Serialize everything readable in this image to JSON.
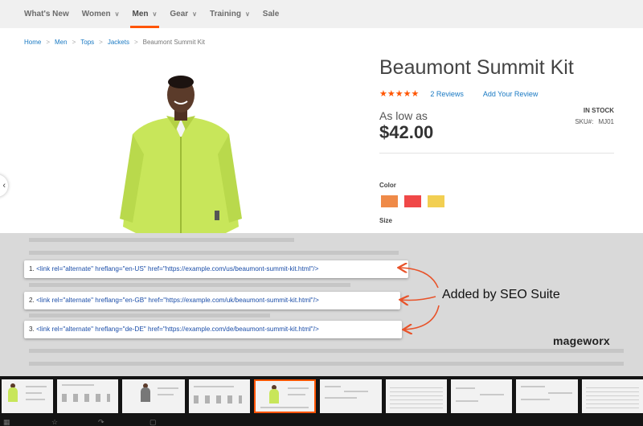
{
  "nav": {
    "items": [
      {
        "label": "What's New",
        "chevron": false,
        "active": false
      },
      {
        "label": "Women",
        "chevron": true,
        "active": false
      },
      {
        "label": "Men",
        "chevron": true,
        "active": true
      },
      {
        "label": "Gear",
        "chevron": true,
        "active": false
      },
      {
        "label": "Training",
        "chevron": true,
        "active": false
      },
      {
        "label": "Sale",
        "chevron": false,
        "active": false
      }
    ]
  },
  "breadcrumb": {
    "items": [
      "Home",
      "Men",
      "Tops",
      "Jackets"
    ],
    "current": "Beaumont Summit Kit"
  },
  "product": {
    "title": "Beaumont Summit Kit",
    "stars": "★★★★★",
    "rating": 4.5,
    "reviews_link": "2  Reviews",
    "add_review": "Add Your Review",
    "as_low_as": "As low as",
    "price": "$42.00",
    "stock": "IN STOCK",
    "sku_label": "SKU#:",
    "sku_value": "MJ01",
    "color_label": "Color",
    "swatches": [
      "#ef8a48",
      "#f04848",
      "#f2cf52"
    ],
    "size_label": "Size"
  },
  "code_lines": [
    {
      "num": "1.",
      "text": "<link rel=\"alternate\" hreflang=\"en-US\" href=\"https://example.com/us/beaumont-summit-kit.html\"/>"
    },
    {
      "num": "2.",
      "text": "<link rel=\"alternate\" hreflang=\"en-GB\" href=\"https://example.com/uk/beaumont-summit-kit.html\"/>"
    },
    {
      "num": "3.",
      "text": "<link rel=\"alternate\" hreflang=\"de-DE\" href=\"https://example.com/de/beaumont-summit-kit.html\"/>"
    }
  ],
  "annotation": "Added by SEO Suite",
  "brand": "mageworx",
  "colors": {
    "accent": "#ff5501",
    "link": "#1979c3",
    "jacket": "#c8e65a"
  },
  "strip": {
    "active_index": 4
  }
}
